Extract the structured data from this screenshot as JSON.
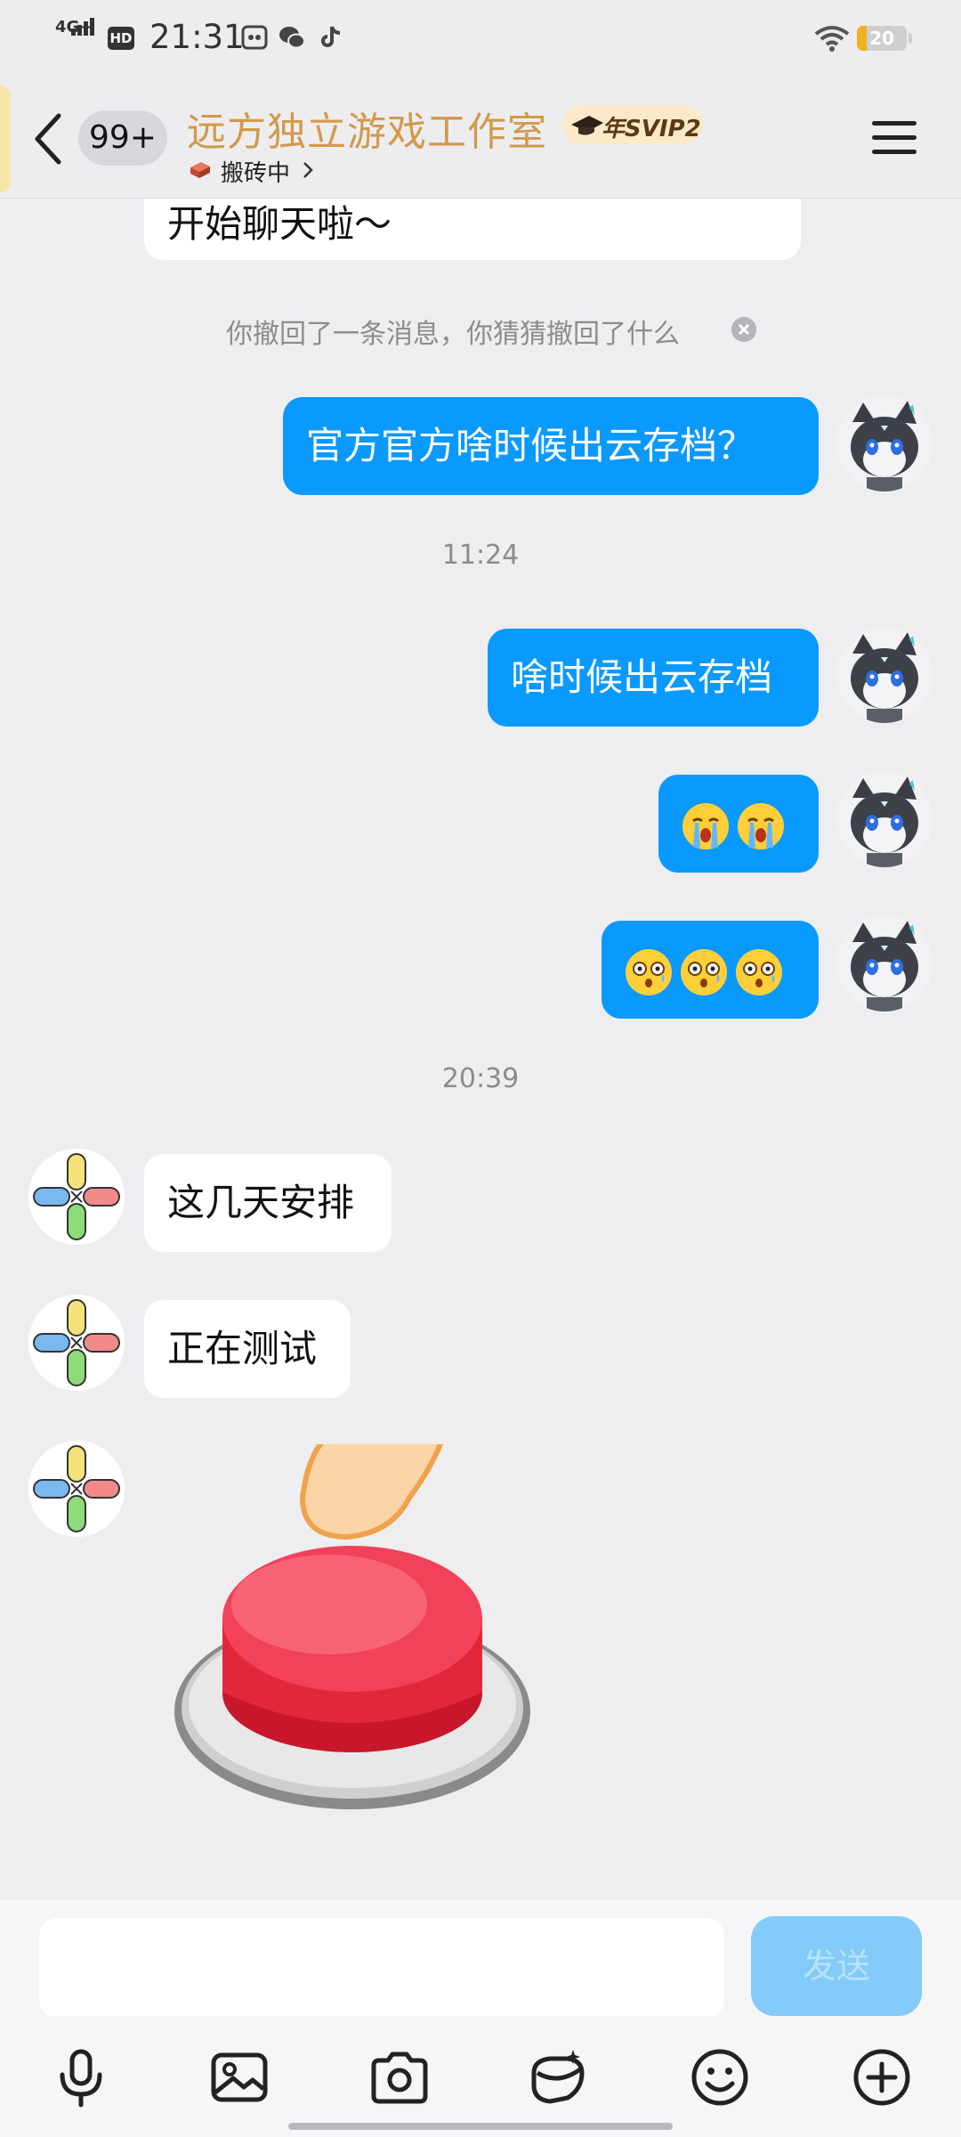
{
  "status_bar": {
    "network": "4G+",
    "hd": "HD",
    "time": "21:31",
    "apps": [
      "screen-icon",
      "wechat-icon",
      "tiktok-icon"
    ],
    "battery": "20",
    "battery_color": "#f2b01e"
  },
  "header": {
    "unread_badge": "99+",
    "title": "远方独立游戏工作室",
    "vip_badge": "年SVIP2",
    "status": "搬砖中",
    "title_color": "#d19a4a"
  },
  "messages": {
    "partial_in": "开始聊天啦～",
    "recall_notice": "你撤回了一条消息，你猜猜撤回了什么",
    "out_1": "官方官方啥时候出云存档？",
    "time_1": "11:24",
    "out_2": "啥时候出云存档",
    "out_3_emoji": [
      "crying-emoji",
      "crying-emoji"
    ],
    "out_4_emoji": [
      "shocked-emoji",
      "shocked-emoji",
      "shocked-emoji"
    ],
    "time_2": "20:39",
    "in_1": "这几天安排",
    "in_2": "正在测试",
    "in_3_sticker": "red-button-sticker"
  },
  "input_bar": {
    "placeholder": "",
    "send_label": "发送"
  },
  "toolbar": [
    "microphone-icon",
    "image-icon",
    "camera-icon",
    "red-packet-icon",
    "emoji-icon",
    "plus-icon"
  ],
  "colors": {
    "outgoing_bubble": "#0a99ff",
    "incoming_bubble": "#ffffff",
    "background": "#eeeef1"
  }
}
